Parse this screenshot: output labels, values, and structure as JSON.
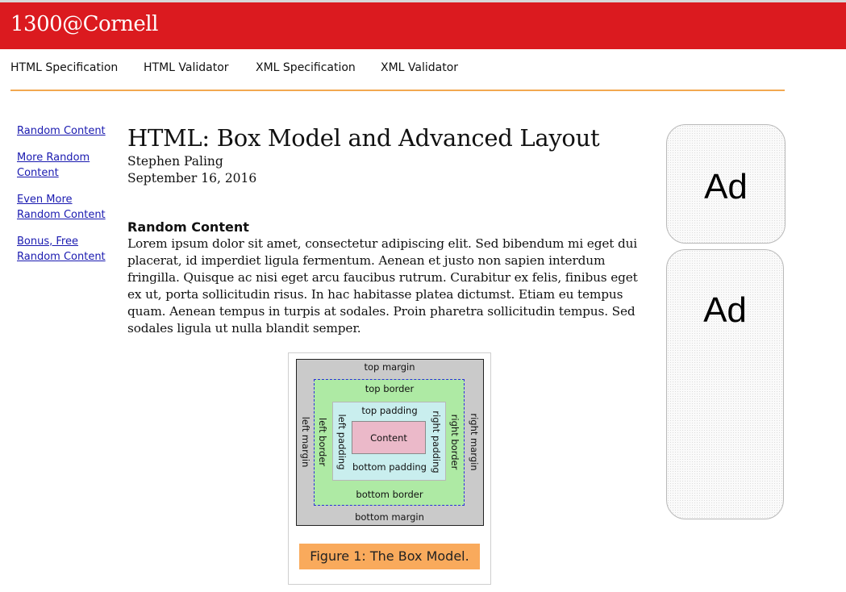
{
  "site": {
    "title": "1300@Cornell"
  },
  "topnav": [
    "HTML Specification",
    "HTML Validator",
    "XML Specification",
    "XML Validator"
  ],
  "sidenav": [
    "Random Content",
    "More Random Content",
    "Even More Random Content",
    "Bonus, Free Random Content"
  ],
  "article": {
    "title": "HTML: Box Model and Advanced Layout",
    "author": "Stephen Paling",
    "date": "September 16, 2016",
    "section_heading": "Random Content",
    "paragraph": "Lorem ipsum dolor sit amet, consectetur adipiscing elit. Sed bibendum mi eget dui placerat, id imperdiet ligula fermentum. Aenean et justo non sapien interdum fringilla. Quisque ac nisi eget arcu faucibus rutrum. Curabitur ex felis, finibus eget ex ut, porta sollicitudin risus. In hac habitasse platea dictumst. Etiam eu tempus quam. Aenean tempus in turpis at sodales. Proin pharetra sollicitudin tempus. Sed sodales ligula ut nulla blandit semper."
  },
  "figure": {
    "labels": {
      "top_margin": "top margin",
      "bottom_margin": "bottom margin",
      "left_margin": "left margin",
      "right_margin": "right margin",
      "top_border": "top border",
      "bottom_border": "bottom border",
      "left_border": "left border",
      "right_border": "right border",
      "top_padding": "top padding",
      "bottom_padding": "bottom padding",
      "left_padding": "left padding",
      "right_padding": "right padding",
      "content": "Content"
    },
    "caption": "Figure 1: The Box Model."
  },
  "ads": [
    "Ad",
    "Ad"
  ],
  "colors": {
    "header": "#db1a1f",
    "nav_rule": "#f2a850",
    "link": "#1a1ab0",
    "caption_bg": "#f9aa5c",
    "margin_box": "#cacaca",
    "border_box": "#aeeaa4",
    "padding_box": "#c9eeee",
    "content_box": "#ebb9c9"
  }
}
